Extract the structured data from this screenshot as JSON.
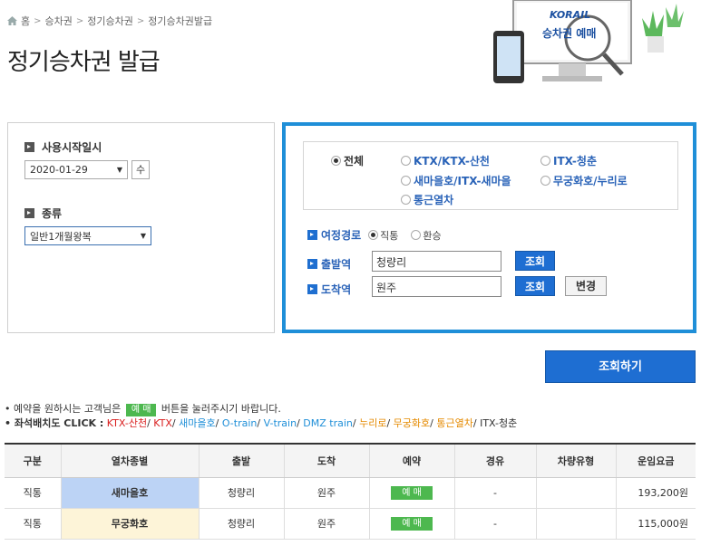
{
  "breadcrumb": [
    "홈",
    "승차권",
    "정기승차권",
    "정기승차권발급"
  ],
  "page_title": "정기승차권 발급",
  "hero": {
    "brand": "KORAIL",
    "caption": "승차권 예매"
  },
  "left_panel": {
    "start_date_label": "사용시작일시",
    "start_date_value": "2020-01-29",
    "day_of_week": "수",
    "type_label": "종류",
    "type_value": "일반1개월왕복"
  },
  "train_types": {
    "all": "전체",
    "ktx": "KTX/KTX-산천",
    "itx_cheongchun": "ITX-청춘",
    "saemaeul": "새마을호/ITX-새마을",
    "mugunghwa": "무궁화호/누리로",
    "commuter": "통근열차"
  },
  "route": {
    "label": "여정경로",
    "direct": "직통",
    "transfer": "환승",
    "departure_label": "출발역",
    "departure_value": "청량리",
    "arrival_label": "도착역",
    "arrival_value": "원주",
    "lookup_label": "조회",
    "change_label": "변경"
  },
  "search_button": "조회하기",
  "notice": {
    "reserve_prefix": "• 예약을 원하시는 고객님은",
    "reserve_badge": "예 매",
    "reserve_suffix": "버튼을 눌러주시기 바랍니다.",
    "seat_label": "• 좌석배치도 CLICK :",
    "seat_links": [
      {
        "text": "KTX-산천",
        "color": "#d92020"
      },
      {
        "text": "KTX",
        "color": "#d92020"
      },
      {
        "text": "새마을호",
        "color": "#1f8fd8"
      },
      {
        "text": "O-train",
        "color": "#1f8fd8"
      },
      {
        "text": "V-train",
        "color": "#1f8fd8"
      },
      {
        "text": "DMZ train",
        "color": "#1f8fd8"
      },
      {
        "text": "누리로",
        "color": "#e58a00"
      },
      {
        "text": "무궁화호",
        "color": "#e58a00"
      },
      {
        "text": "통근열차",
        "color": "#e58a00"
      },
      {
        "text": "ITX-청춘",
        "color": "#333333"
      }
    ]
  },
  "table": {
    "headers": [
      "구분",
      "열차종별",
      "출발",
      "도착",
      "예약",
      "경유",
      "차량유형",
      "운임요금"
    ],
    "rows": [
      {
        "gubun": "직통",
        "train": "새마을호",
        "dep": "청량리",
        "arr": "원주",
        "reserve": "예 매",
        "via": "-",
        "car": "",
        "fare": "193,200원"
      },
      {
        "gubun": "직통",
        "train": "무궁화호",
        "dep": "청량리",
        "arr": "원주",
        "reserve": "예 매",
        "via": "-",
        "car": "",
        "fare": "115,000원"
      }
    ]
  }
}
